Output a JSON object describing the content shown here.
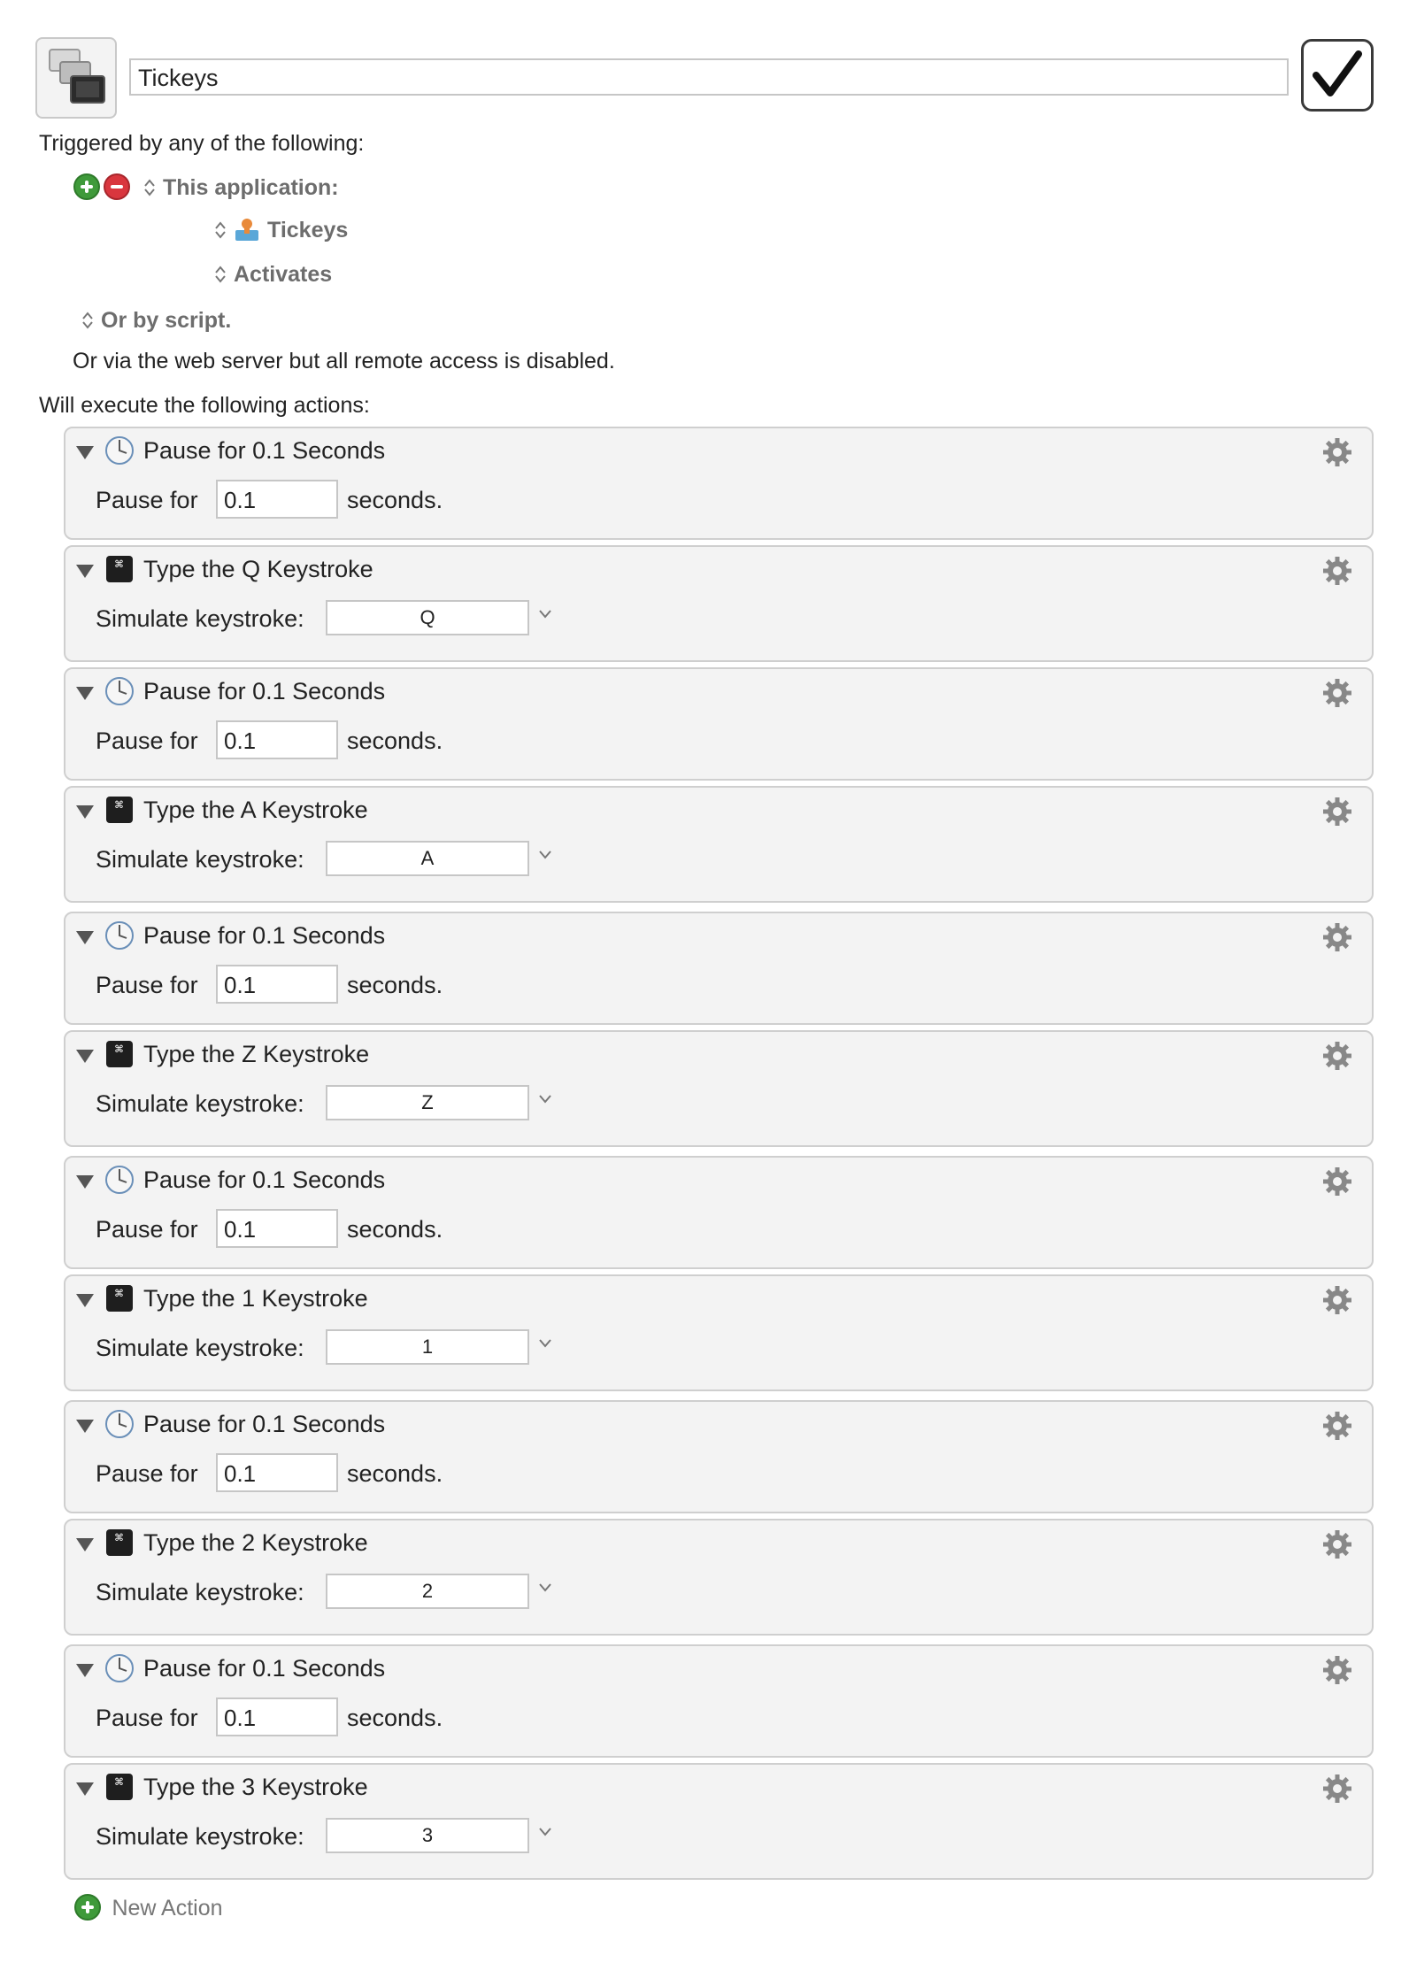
{
  "macro": {
    "name": "Tickeys",
    "enabled": true
  },
  "triggers": {
    "heading": "Triggered by any of the following:",
    "trigger_type": "This application:",
    "application": "Tickeys",
    "event": "Activates",
    "script": "Or by script.",
    "web_server": "Or via the web server but all remote access is disabled."
  },
  "actions_heading": "Will execute the following actions:",
  "actions": [
    {
      "type": "pause",
      "title": "Pause for 0.1 Seconds",
      "label": "Pause for",
      "value": "0.1",
      "unit": "seconds."
    },
    {
      "type": "keystroke",
      "title": "Type the Q Keystroke",
      "label": "Simulate keystroke:",
      "key": "Q"
    },
    {
      "type": "pause",
      "title": "Pause for 0.1 Seconds",
      "label": "Pause for",
      "value": "0.1",
      "unit": "seconds."
    },
    {
      "type": "keystroke",
      "title": "Type the A Keystroke",
      "label": "Simulate keystroke:",
      "key": "A"
    },
    {
      "type": "pause",
      "title": "Pause for 0.1 Seconds",
      "label": "Pause for",
      "value": "0.1",
      "unit": "seconds."
    },
    {
      "type": "keystroke",
      "title": "Type the Z Keystroke",
      "label": "Simulate keystroke:",
      "key": "Z"
    },
    {
      "type": "pause",
      "title": "Pause for 0.1 Seconds",
      "label": "Pause for",
      "value": "0.1",
      "unit": "seconds."
    },
    {
      "type": "keystroke",
      "title": "Type the 1 Keystroke",
      "label": "Simulate keystroke:",
      "key": "1"
    },
    {
      "type": "pause",
      "title": "Pause for 0.1 Seconds",
      "label": "Pause for",
      "value": "0.1",
      "unit": "seconds."
    },
    {
      "type": "keystroke",
      "title": "Type the 2 Keystroke",
      "label": "Simulate keystroke:",
      "key": "2"
    },
    {
      "type": "pause",
      "title": "Pause for 0.1 Seconds",
      "label": "Pause for",
      "value": "0.1",
      "unit": "seconds."
    },
    {
      "type": "keystroke",
      "title": "Type the 3 Keystroke",
      "label": "Simulate keystroke:",
      "key": "3"
    }
  ],
  "new_action_label": "New Action",
  "colors": {
    "add": "#3f9a3a",
    "remove": "#d9363e",
    "action_bg": "#f3f3f3",
    "popup_text": "#6d6d6d"
  }
}
